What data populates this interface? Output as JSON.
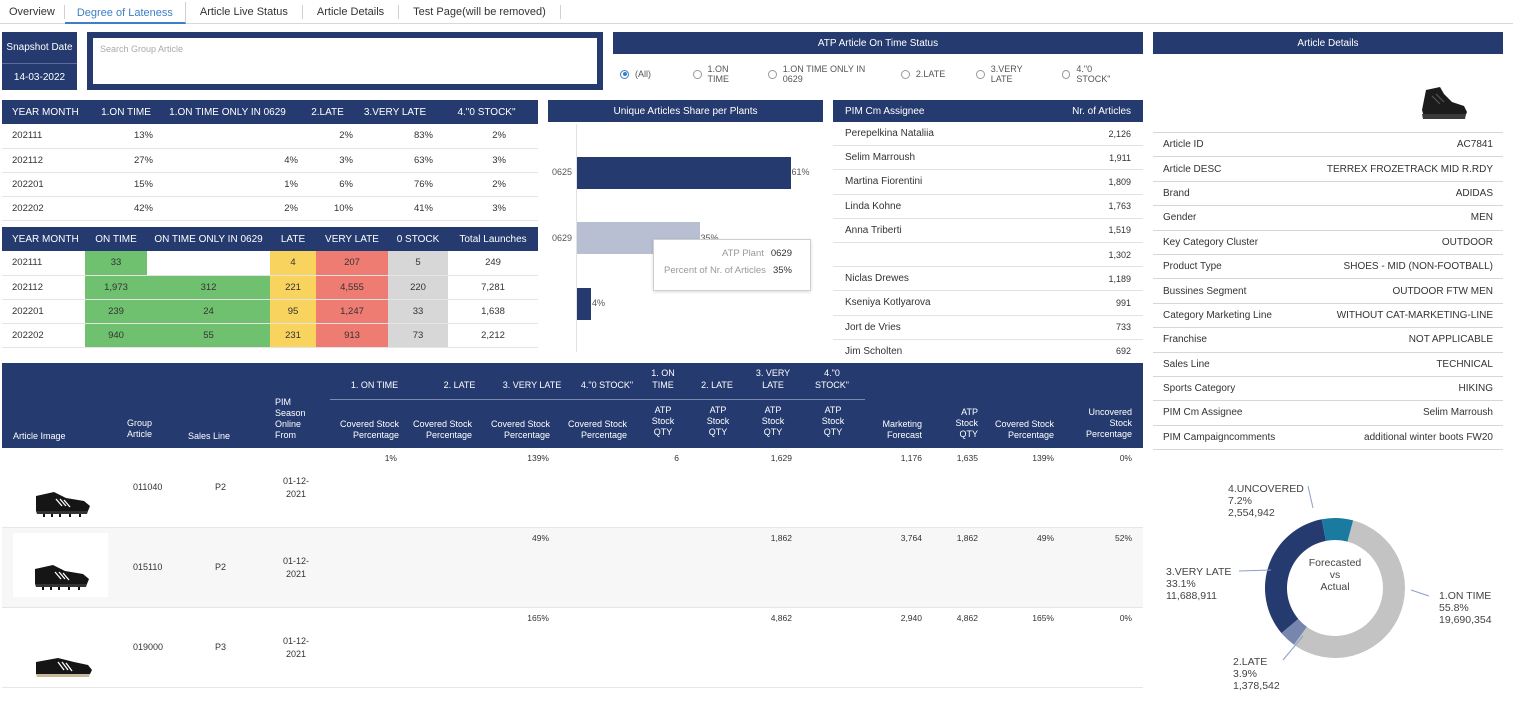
{
  "tabs": [
    "Overview",
    "Degree of Lateness",
    "Article Live Status",
    "Article Details",
    "Test Page(will be removed)"
  ],
  "snapshot": {
    "label": "Snapshot Date",
    "date": "14-03-2022"
  },
  "search": {
    "placeholder": "Search Group Article"
  },
  "atp_status": {
    "title": "ATP Article On Time Status",
    "options": [
      "(All)",
      "1.ON TIME",
      "1.ON TIME ONLY IN 0629",
      "2.LATE",
      "3.VERY LATE",
      "4.\"0 STOCK\""
    ],
    "selected": "(All)"
  },
  "pct_table": {
    "headers": [
      "YEAR MONTH",
      "1.ON TIME",
      "1.ON TIME ONLY IN 0629",
      "2.LATE",
      "3.VERY LATE",
      "4.\"0 STOCK\""
    ],
    "rows": [
      [
        "202111",
        "13%",
        "",
        "2%",
        "83%",
        "2%"
      ],
      [
        "202112",
        "27%",
        "4%",
        "3%",
        "63%",
        "3%"
      ],
      [
        "202201",
        "15%",
        "1%",
        "6%",
        "76%",
        "2%"
      ],
      [
        "202202",
        "42%",
        "2%",
        "10%",
        "41%",
        "3%"
      ]
    ]
  },
  "count_table": {
    "headers": [
      "YEAR MONTH",
      "ON TIME",
      "ON TIME ONLY IN 0629",
      "LATE",
      "VERY LATE",
      "0 STOCK",
      "Total Launches"
    ],
    "rows": [
      [
        "202111",
        "33",
        "",
        "4",
        "207",
        "5",
        "249"
      ],
      [
        "202112",
        "1,973",
        "312",
        "221",
        "4,555",
        "220",
        "7,281"
      ],
      [
        "202201",
        "239",
        "24",
        "95",
        "1,247",
        "33",
        "1,638"
      ],
      [
        "202202",
        "940",
        "55",
        "231",
        "913",
        "73",
        "2,212"
      ]
    ]
  },
  "plants_chart": {
    "title": "Unique Articles Share per Plants",
    "bars": [
      {
        "label": "0625",
        "value": 61,
        "text": "61%",
        "color": "#253a6e"
      },
      {
        "label": "0629",
        "value": 35,
        "text": "35%",
        "color": "#b9bfd3"
      },
      {
        "label": "",
        "value": 4,
        "text": "4%",
        "color": "#253a6e"
      }
    ],
    "tooltip": {
      "k1": "ATP Plant",
      "v1": "0629",
      "k2": "Percent of Nr. of Articles",
      "v2": "35%"
    }
  },
  "pim": {
    "headers": [
      "PIM Cm Assignee",
      "Nr. of Articles"
    ],
    "rows": [
      [
        "Perepelkina Nataliia",
        "2,126"
      ],
      [
        "Selim Marroush",
        "1,911"
      ],
      [
        "Martina Fiorentini",
        "1,809"
      ],
      [
        "Linda Kohne",
        "1,763"
      ],
      [
        "Anna Triberti",
        "1,519"
      ],
      [
        "",
        "1,302"
      ],
      [
        "Niclas Drewes",
        "1,189"
      ],
      [
        "Kseniya Kotlyarova",
        "991"
      ],
      [
        "Jort de Vries",
        "733"
      ],
      [
        "Jim Scholten",
        "692"
      ]
    ]
  },
  "article_details": {
    "title": "Article Details",
    "rows": [
      [
        "Article ID",
        "AC7841"
      ],
      [
        "Article DESC",
        "TERREX FROZETRACK MID R.RDY"
      ],
      [
        "Brand",
        "ADIDAS"
      ],
      [
        "Gender",
        "MEN"
      ],
      [
        "Key Category Cluster",
        "OUTDOOR"
      ],
      [
        "Product Type",
        "SHOES - MID (NON-FOOTBALL)"
      ],
      [
        "Bussines Segment",
        "OUTDOOR FTW MEN"
      ],
      [
        "Category Marketing Line",
        "WITHOUT CAT-MARKETING-LINE"
      ],
      [
        "Franchise",
        "NOT APPLICABLE"
      ],
      [
        "Sales Line",
        "TECHNICAL"
      ],
      [
        "Sports Category",
        "HIKING"
      ],
      [
        "PIM Cm Assignee",
        "Selim Marroush"
      ],
      [
        "PIM Campaigncomments",
        "additional winter boots FW20"
      ]
    ]
  },
  "big_table": {
    "group_headers": [
      "1. ON TIME",
      "2. LATE",
      "3. VERY LATE",
      "4.\"0 STOCK\"",
      "1. ON TIME",
      "2. LATE",
      "3. VERY LATE",
      "4.\"0 STOCK\""
    ],
    "col_headers": [
      "Article Image",
      "Group Article",
      "Sales Line",
      "PIM Season Online From",
      "Covered Stock Percentage",
      "Covered Stock Percentage",
      "Covered Stock Percentage",
      "Covered Stock Percentage",
      "ATP Stock QTY",
      "ATP Stock QTY",
      "ATP Stock QTY",
      "ATP Stock QTY",
      "Marketing Forecast",
      "ATP Stock QTY",
      "Covered Stock Percentage",
      "Uncovered Stock Percentage"
    ],
    "rows": [
      {
        "article": "011040",
        "line": "P2",
        "date": "01-12-2021",
        "c1": "1%",
        "c2": "",
        "c3": "139%",
        "c4": "",
        "a1": "6",
        "a2": "",
        "a3": "1,629",
        "a4": "",
        "mf": "1,176",
        "atp": "1,635",
        "cov": "139%",
        "unc": "0%"
      },
      {
        "article": "015110",
        "line": "P2",
        "date": "01-12-2021",
        "c1": "",
        "c2": "",
        "c3": "49%",
        "c4": "",
        "a1": "",
        "a2": "",
        "a3": "1,862",
        "a4": "",
        "mf": "3,764",
        "atp": "1,862",
        "cov": "49%",
        "unc": "52%"
      },
      {
        "article": "019000",
        "line": "P3",
        "date": "01-12-2021",
        "c1": "",
        "c2": "",
        "c3": "165%",
        "c4": "",
        "a1": "",
        "a2": "",
        "a3": "4,862",
        "a4": "",
        "mf": "2,940",
        "atp": "4,862",
        "cov": "165%",
        "unc": "0%"
      }
    ]
  },
  "donut": {
    "center": [
      "Forecasted",
      "vs",
      "Actual"
    ],
    "segments": [
      {
        "name": "1.ON TIME",
        "pct": "55.8%",
        "val": "19,690,354",
        "share": 55.8,
        "color": "#c3c3c3"
      },
      {
        "name": "2.LATE",
        "pct": "3.9%",
        "val": "1,378,542",
        "share": 3.9,
        "color": "#7686ad"
      },
      {
        "name": "3.VERY LATE",
        "pct": "33.1%",
        "val": "11,688,911",
        "share": 33.1,
        "color": "#253a6e"
      },
      {
        "name": "4.UNCOVERED",
        "pct": "7.2%",
        "val": "2,554,942",
        "share": 7.2,
        "color": "#1a7aa0"
      }
    ]
  }
}
